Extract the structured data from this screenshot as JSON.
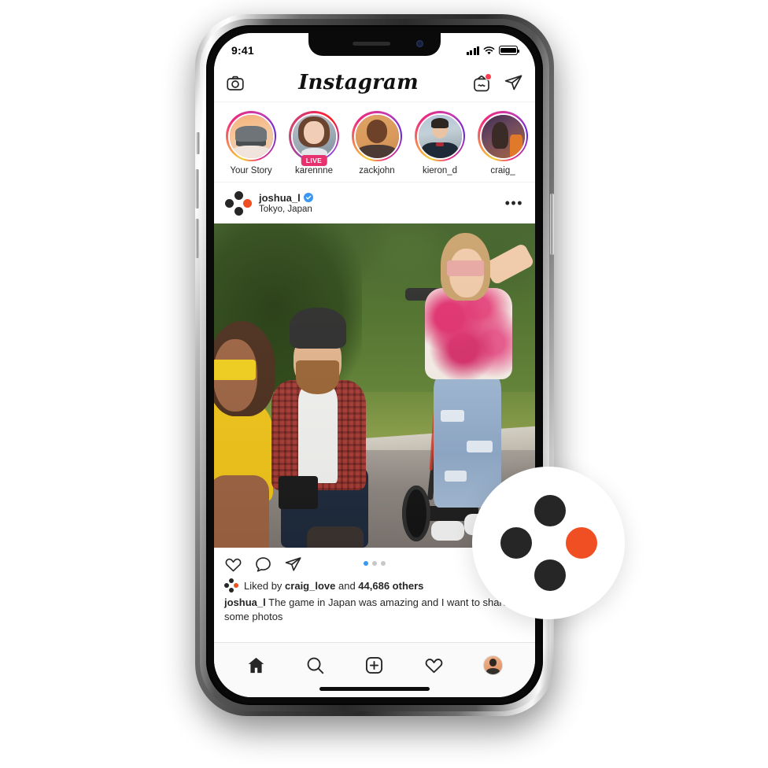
{
  "status_bar": {
    "time": "9:41",
    "signal_icon": "signal-bars-icon",
    "wifi_icon": "wifi-icon",
    "battery_icon": "battery-full-icon"
  },
  "app": {
    "wordmark": "Instagram",
    "camera_icon": "camera-icon",
    "igtv_icon": "igtv-icon",
    "direct_message_icon": "paper-plane-icon",
    "has_igtv_notification": true
  },
  "stories": [
    {
      "label": "Your Story",
      "ring": "gradient",
      "live": false
    },
    {
      "label": "karennne",
      "ring": "purple",
      "live": true,
      "live_label": "LIVE"
    },
    {
      "label": "zackjohn",
      "ring": "gradient",
      "live": false
    },
    {
      "label": "kieron_d",
      "ring": "gradient",
      "live": false
    },
    {
      "label": "craig_",
      "ring": "gradient",
      "live": false
    }
  ],
  "post": {
    "username": "joshua_l",
    "verified": true,
    "location": "Tokyo, Japan",
    "more_options": "•••",
    "like_icon": "heart-icon",
    "comment_icon": "comment-bubble-icon",
    "share_icon": "paper-plane-icon",
    "carousel_total": 3,
    "carousel_active": 1,
    "likes_prefix": "Liked by ",
    "likes_user": "craig_love",
    "likes_middle": " and ",
    "likes_count": "44,686 others",
    "caption_user": "joshua_l",
    "caption_text": " The game in Japan was amazing and I want to share some photos"
  },
  "bottom_nav": [
    {
      "name": "home",
      "icon": "home-icon",
      "active": true
    },
    {
      "name": "search",
      "icon": "search-icon",
      "active": false
    },
    {
      "name": "add",
      "icon": "plus-square-icon",
      "active": false
    },
    {
      "name": "activity",
      "icon": "heart-icon",
      "active": false
    },
    {
      "name": "profile",
      "icon": "profile-avatar-icon",
      "active": false
    }
  ],
  "brand_badge": {
    "dot_color_dark": "#262626",
    "dot_color_accent": "#F04E23"
  },
  "colors": {
    "accent_orange": "#F04E23",
    "verified_blue": "#3897F0",
    "live_pink": "#E6326E",
    "text_primary": "#262626"
  }
}
